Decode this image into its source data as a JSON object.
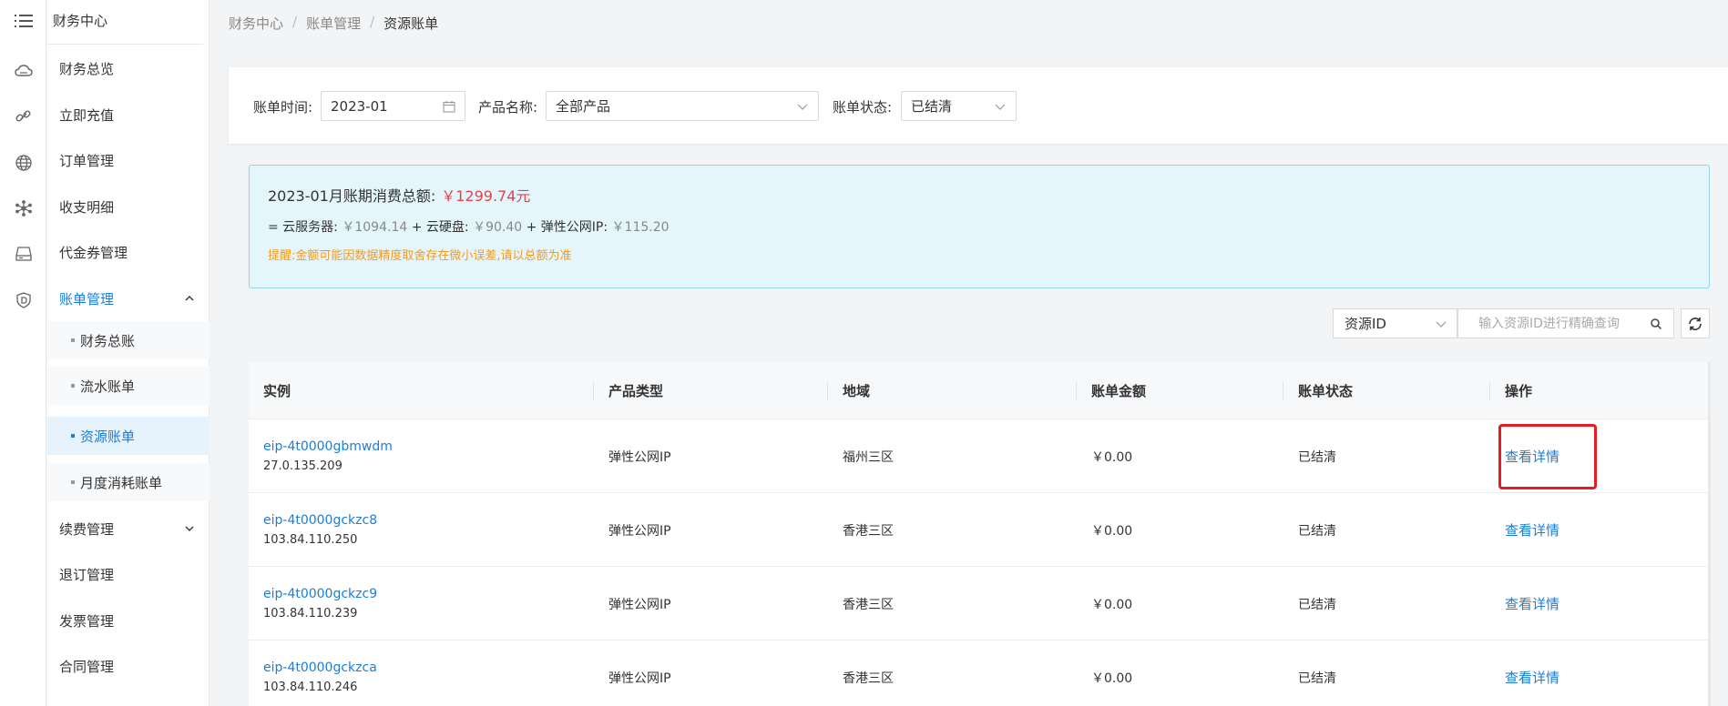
{
  "sidebar": {
    "header": "财务中心",
    "items": [
      {
        "label": "财务总览"
      },
      {
        "label": "立即充值"
      },
      {
        "label": "订单管理"
      },
      {
        "label": "收支明细"
      },
      {
        "label": "代金券管理"
      },
      {
        "label": "账单管理",
        "expanded": true
      },
      {
        "label": "续费管理"
      },
      {
        "label": "退订管理"
      },
      {
        "label": "发票管理"
      },
      {
        "label": "合同管理"
      }
    ],
    "sub_items": [
      {
        "label": "财务总账"
      },
      {
        "label": "流水账单"
      },
      {
        "label": "资源账单",
        "active": true
      },
      {
        "label": "月度消耗账单"
      }
    ]
  },
  "rail_icons": [
    "menu-icon",
    "cloud-icon",
    "link-icon",
    "globe-icon",
    "network-icon",
    "storage-icon",
    "shield-icon"
  ],
  "breadcrumb": [
    "财务中心",
    "账单管理",
    "资源账单"
  ],
  "breadcrumb_sep": "/",
  "filter": {
    "bill_time_label": "账单时间:",
    "bill_time_value": "2023-01",
    "product_label": "产品名称:",
    "product_value": "全部产品",
    "status_label": "账单状态:",
    "status_value": "已结清"
  },
  "summary": {
    "title": "2023-01月账期消费总额:",
    "total": "￥1299.74元",
    "prefix": "= 云服务器:",
    "cvm": "￥1094.14",
    "plus1": "+ 云硬盘:",
    "disk": "￥90.40",
    "plus2": "+ 弹性公网IP:",
    "eip": "￥115.20",
    "notice": "提醒:金额可能因数据精度取舍存在微小误差,请以总额为准"
  },
  "search": {
    "select_value": "资源ID",
    "placeholder": "输入资源ID进行精确查询"
  },
  "table": {
    "headers": [
      "实例",
      "产品类型",
      "地域",
      "账单金额",
      "账单状态",
      "操作"
    ],
    "rows": [
      {
        "id": "eip-4t0000gbmwdm",
        "ip": "27.0.135.209",
        "type": "弹性公网IP",
        "region": "福州三区",
        "amount": "￥0.00",
        "status": "已结清",
        "action": "查看详情"
      },
      {
        "id": "eip-4t0000gckzc8",
        "ip": "103.84.110.250",
        "type": "弹性公网IP",
        "region": "香港三区",
        "amount": "￥0.00",
        "status": "已结清",
        "action": "查看详情"
      },
      {
        "id": "eip-4t0000gckzc9",
        "ip": "103.84.110.239",
        "type": "弹性公网IP",
        "region": "香港三区",
        "amount": "￥0.00",
        "status": "已结清",
        "action": "查看详情"
      },
      {
        "id": "eip-4t0000gckzca",
        "ip": "103.84.110.246",
        "type": "弹性公网IP",
        "region": "香港三区",
        "amount": "￥0.00",
        "status": "已结清",
        "action": "查看详情"
      }
    ]
  },
  "colors": {
    "accent": "#1a7ddb",
    "total_red": "#e0434c",
    "notice_orange": "#f29a1f",
    "highlight_red": "#e51c23"
  }
}
